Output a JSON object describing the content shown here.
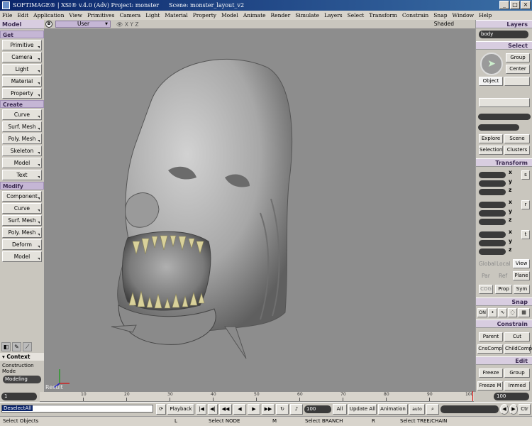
{
  "window": {
    "title": "SOFTIMAGE® | XSI® v.4.0 (Adv) Project: monster",
    "scene": "Scene: monster_layout_v2"
  },
  "menu": [
    "File",
    "Edit",
    "Application",
    "View",
    "Primitives",
    "Camera",
    "Light",
    "Material",
    "Property",
    "Model",
    "Animate",
    "Render",
    "Simulate",
    "Layers",
    "Select",
    "Transform",
    "Constrain",
    "Snap",
    "Window",
    "Help"
  ],
  "left": {
    "module": "Model",
    "get_label": "Get",
    "get": [
      "Primitive",
      "Camera",
      "Light",
      "Material",
      "Property"
    ],
    "create_label": "Create",
    "create": [
      "Curve",
      "Surf. Mesh",
      "Poly. Mesh",
      "Skeleton",
      "Model",
      "Text"
    ],
    "modify_label": "Modify",
    "modify": [
      "Component",
      "Curve",
      "Surf. Mesh",
      "Poly. Mesh",
      "Deform",
      "Model"
    ],
    "context_label": "Context",
    "construction_mode_label": "Construction Mode",
    "construction_mode": "Modeling"
  },
  "viewport": {
    "badge": "B",
    "view": "User",
    "icons": "👁 X Y Z",
    "shading": "Shaded",
    "result": "Result"
  },
  "right": {
    "layers_label": "Layers",
    "layer": "body",
    "select_label": "Select",
    "group": "Group",
    "center": "Center",
    "object": "Object",
    "explore": "Explore",
    "scene": "Scene",
    "selection": "Selection",
    "clusters": "Clusters",
    "transform_label": "Transform",
    "axis": [
      "x",
      "y",
      "z"
    ],
    "srt": [
      "s",
      "r",
      "t"
    ],
    "global": "Global",
    "local": "Local",
    "view": "View",
    "par": "Par",
    "ref": "Ref",
    "plane": "Plane",
    "cog": "COG",
    "prop": "Prop",
    "sym": "Sym",
    "snap_label": "Snap",
    "snap_on": "ON",
    "constrain_label": "Constrain",
    "parent": "Parent",
    "cut": "Cut",
    "cnscomp": "CnsComp",
    "childcomp": "ChildComp",
    "edit_label": "Edit",
    "freeze": "Freeze",
    "group2": "Group",
    "freeze_m": "Freeze M",
    "immed": "Immed"
  },
  "timeline": {
    "start": "1",
    "end": "100",
    "ticks": [
      "10",
      "20",
      "30",
      "40",
      "50",
      "60",
      "70",
      "80",
      "90",
      "100"
    ]
  },
  "playbar": {
    "command": "DeselectAll",
    "playback": "Playback",
    "frame": "100",
    "all": "All",
    "update_all": "Update All",
    "animation": "Animation",
    "auto": "auto",
    "ctrl": "Ctr"
  },
  "status": {
    "left": "Select Objects",
    "l": "L",
    "l_text": "Select NODE",
    "m": "M",
    "m_text": "Select BRANCH",
    "r": "R",
    "r_text": "Select TREE/CHAIN"
  }
}
